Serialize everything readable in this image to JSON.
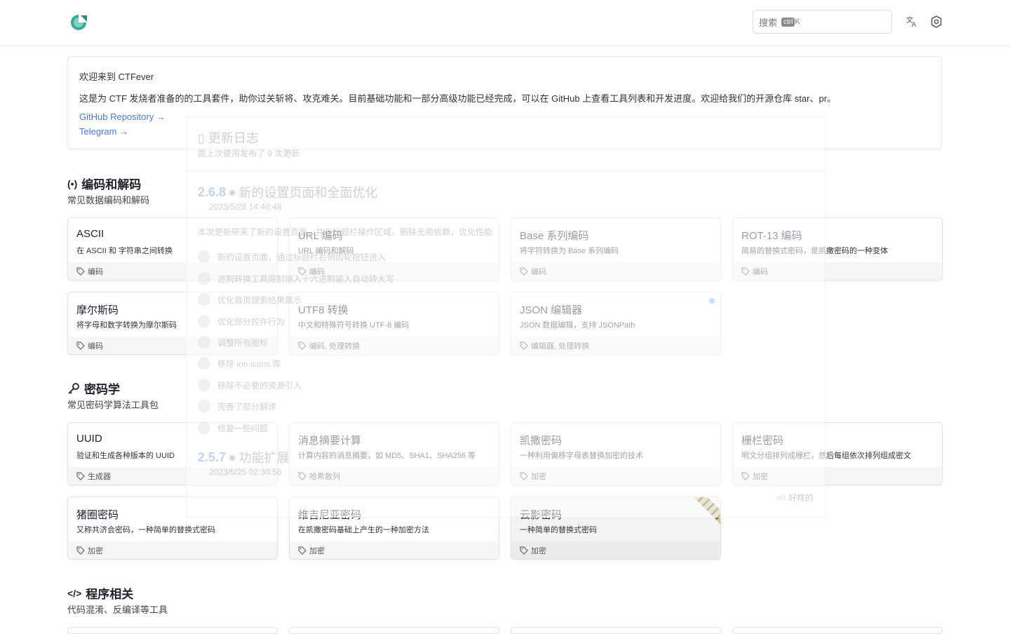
{
  "header": {
    "search_label": "搜索",
    "search_kbd": "ctrl",
    "search_key": "K",
    "accent": "#3aa99a"
  },
  "welcome": {
    "title": "欢迎来到 CTFever",
    "desc": "这是为 CTF 发烧者准备的的工具套件，助你过关斩将、攻克难关。目前基础功能和一部分高级功能已经完成，可以在 GitHub 上查看工具列表和开发进度。欢迎给我们的开源仓库 star、pr。",
    "links": [
      "GitHub Repository →",
      "Telegram →"
    ]
  },
  "sections": [
    {
      "icon": "(•)",
      "title": "编码和解码",
      "subtitle": "常见数据编码和解码",
      "cards": [
        {
          "name": "ASCII",
          "desc": "在 ASCII 和 字符串之间转换",
          "tag": "编码"
        },
        {
          "name": "URL 编码",
          "desc": "URL 编码和解码",
          "tag": "编码"
        },
        {
          "name": "Base 系列编码",
          "desc": "将字符转换为 Base 系列编码",
          "tag": "编码"
        },
        {
          "name": "ROT-13 编码",
          "desc": "简易的替换式密码，是凯撒密码的一种变体",
          "tag": "编码"
        },
        {
          "name": "摩尔斯码",
          "desc": "将字母和数字转换为摩尔斯码",
          "tag": "编码"
        },
        {
          "name": "UTF8 转换",
          "desc": "中文和特殊符号转换 UTF-8 编码",
          "tag": "编码, 处理转换"
        },
        {
          "name": "JSON 编辑器",
          "desc": "JSON 数据编辑，支持 JSONPath",
          "tag": "编辑器, 处理转换"
        }
      ]
    },
    {
      "icon": "key",
      "title": "密码学",
      "subtitle": "常见密码学算法工具包",
      "cards": [
        {
          "name": "UUID",
          "desc": "验证和生成各种版本的 UUID",
          "tag": "生成器"
        },
        {
          "name": "消息摘要计算",
          "desc": "计算内容的消息摘要，如 MD5、SHA1、SHA256 等",
          "tag": "哈希散列"
        },
        {
          "name": "凯撒密码",
          "desc": "一种利用偏移字母表替换加密的技术",
          "tag": "加密"
        },
        {
          "name": "栅栏密码",
          "desc": "明文分组排列成栅栏，然后每组依次排列组成密文",
          "tag": "加密"
        },
        {
          "name": "猪圈密码",
          "desc": "又称共济会密码，一种简单的替换式密码",
          "tag": "加密"
        },
        {
          "name": "维吉尼亚密码",
          "desc": "在凯撒密码基础上产生的一种加密方法",
          "tag": "加密"
        },
        {
          "name": "云影密码",
          "desc": "一种简单的替换式密码",
          "tag": "加密"
        }
      ]
    },
    {
      "icon": "</>",
      "title": "程序相关",
      "subtitle": "代码混淆、反编译等工具"
    }
  ],
  "changelog": {
    "title": "更新日志",
    "subtitle": "距上次使用发布了 9 次更新",
    "v1": {
      "version": "2.6.8",
      "title": "新的设置页面和全面优化",
      "date": "2023/5/28 14:40:48"
    },
    "intro": "本次更新带来了新的设置页面，并在标题栏操作区域，删除无用依赖，优化性能",
    "items": [
      "新的设置页面，通过标题栏右侧齿轮按钮进入",
      "进制转换工具限制输入十六进制输入自动转大写",
      "优化首页搜索结果展示",
      "优化部分控件行为",
      "调整所有图标",
      "移除 ion-icons 库",
      "移除不必要的资源引入",
      "完善了部分翻译",
      "修复一些问题"
    ],
    "v2": {
      "version": "2.5.7",
      "title": "功能扩展",
      "date": "2023/5/25 02:30:58"
    },
    "like": "好样的"
  }
}
